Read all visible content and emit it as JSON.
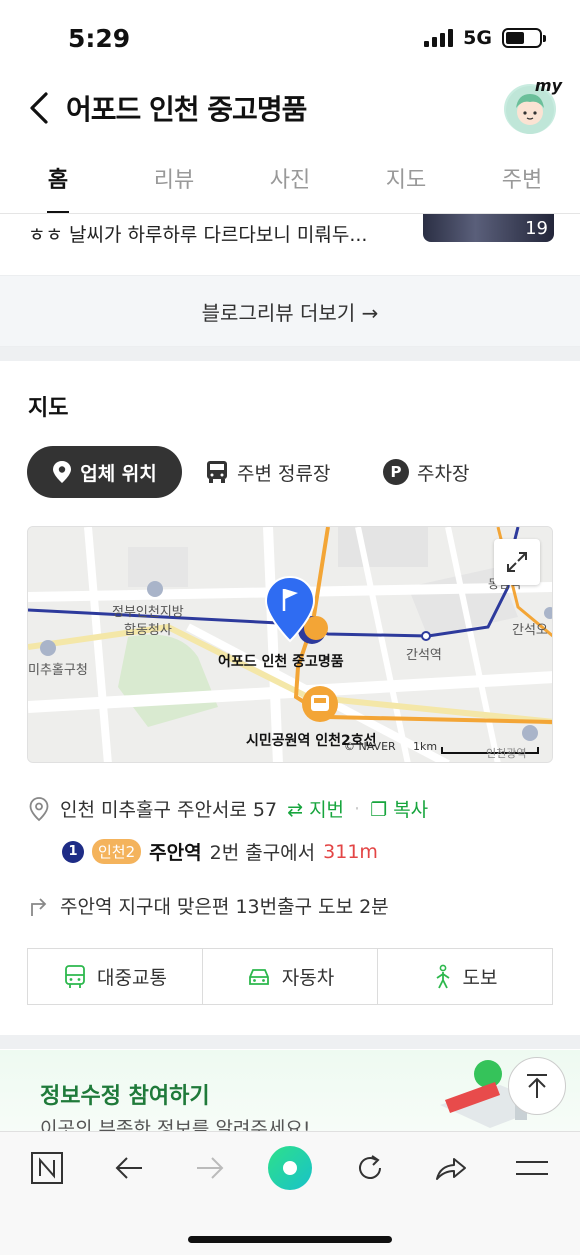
{
  "status": {
    "time": "5:29",
    "network": "5G"
  },
  "header": {
    "title": "어포드 인천 중고명품",
    "avatar_badge": "my"
  },
  "tabs": [
    {
      "label": "홈",
      "active": true
    },
    {
      "label": "리뷰",
      "active": false
    },
    {
      "label": "사진",
      "active": false
    },
    {
      "label": "지도",
      "active": false
    },
    {
      "label": "주변",
      "active": false
    }
  ],
  "blog": {
    "snippet": "ㅎㅎ 날씨가 하루하루 다르다보니 미뤄두...",
    "photo_count": "19",
    "more_label": "블로그리뷰 더보기 →"
  },
  "map_section": {
    "title": "지도",
    "chips": {
      "location": "업체 위치",
      "stops": "주변 정류장",
      "parking": "주차장"
    },
    "labels": {
      "gov": "정부인천지방\n합동청사",
      "gov1": "정부인천지방",
      "gov2": "합동청사",
      "district": "미추홀구청",
      "station_east": "동암역",
      "station_ganseok": "간석역",
      "station_ganseok5": "간석오",
      "store": "어포드 인천 중고명품",
      "bus_stop": "시민공원역 인천2호선",
      "credit": "© NAVER",
      "scale": "1km",
      "bottom_label": "인천광역"
    },
    "colors": {
      "route_blue": "#2d3a9c",
      "route_orange": "#f3a536",
      "pin_blue": "#2f6cf2"
    }
  },
  "info": {
    "address": "인천 미추홀구 주안서로 57",
    "jibun_label": "지번",
    "copy_label": "복사",
    "line_number": "1",
    "line2_label": "인천2",
    "station": "주안역",
    "exit_text": "2번 출구에서",
    "distance": "311m",
    "directions": "주안역 지구대 맞은편 13번출구 도보 2분"
  },
  "transport": {
    "transit": "대중교통",
    "car": "자동차",
    "walk": "도보"
  },
  "contribute": {
    "title": "정보수정 참여하기",
    "subtitle": "이곳의 부족한 정보를 알려주세요!"
  }
}
